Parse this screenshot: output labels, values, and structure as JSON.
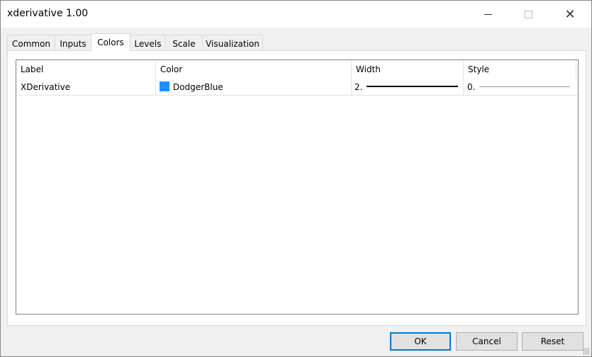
{
  "window": {
    "title": "xderivative 1.00"
  },
  "tabs": [
    {
      "label": "Common"
    },
    {
      "label": "Inputs"
    },
    {
      "label": "Colors"
    },
    {
      "label": "Levels"
    },
    {
      "label": "Scale"
    },
    {
      "label": "Visualization"
    }
  ],
  "table": {
    "columns": [
      "Label",
      "Color",
      "Width",
      "Style"
    ],
    "rows": [
      {
        "label": "XDerivative",
        "color": "DodgerBlue",
        "color_hex": "#1e90ff",
        "width": "2.",
        "style": "0."
      }
    ]
  },
  "buttons": {
    "ok": "OK",
    "cancel": "Cancel",
    "reset": "Reset"
  }
}
